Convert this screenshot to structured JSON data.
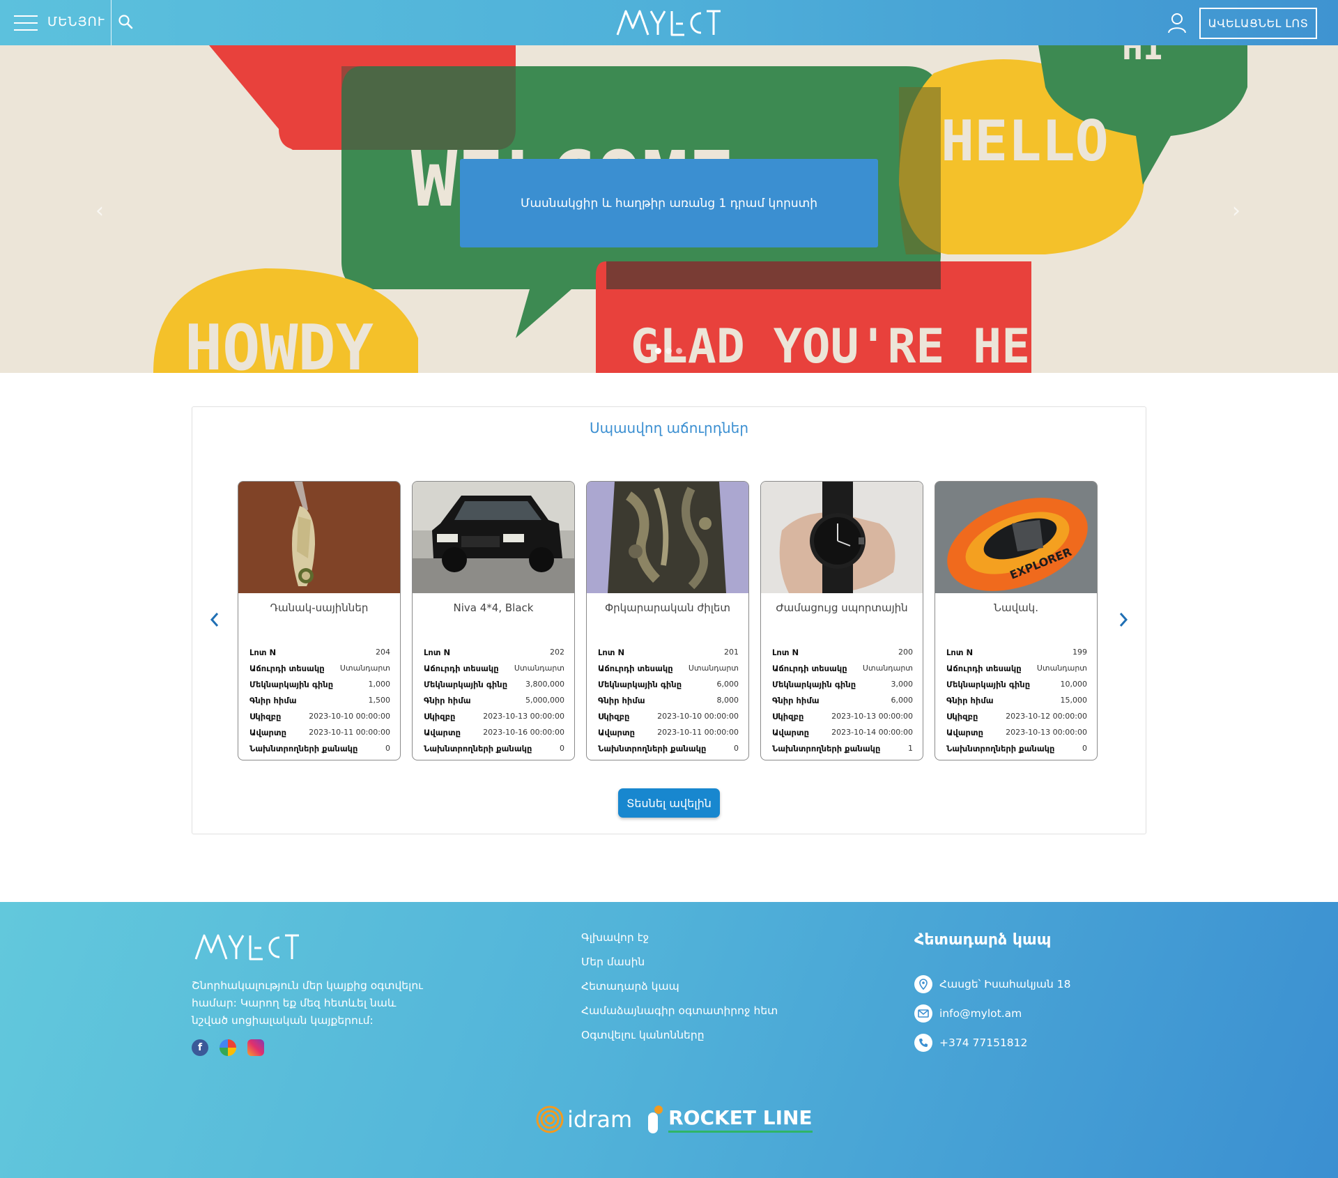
{
  "header": {
    "menu_label": "ՄԵՆՅՈՒ",
    "logo_text": "MYLOT",
    "add_lot_label": "ԱՎԵԼԱՑՆԵԼ ԼՈՏ"
  },
  "hero": {
    "cta_text": "Մասնակցիր և հաղթիր առանց 1 դրամ կորստի",
    "banner_words": [
      "WELCOME",
      "HELLO",
      "HOWDY",
      "GLAD YOU'RE HERE",
      "HI"
    ],
    "slides_count": 3,
    "active_slide": 1
  },
  "auctions": {
    "title": "Սպասվող աճուրդներ",
    "see_more_label": "Տեսնել ավելին",
    "row_labels": [
      "Լոտ N",
      "Աճուրդի տեսակը",
      "Մեկնարկային գինը",
      "Գնիր հիմա",
      "Սկիզբը",
      "Ավարտը",
      "Նախնտրողների քանակը"
    ],
    "cards": [
      {
        "title": "Դանակ-սայիններ",
        "lot": "204",
        "type": "Ստանդարտ",
        "start_price": "1,000",
        "buy_now": "1,500",
        "start": "2023-10-10 00:00:00",
        "end": "2023-10-11 00:00:00",
        "favorites": "0",
        "image": "knife"
      },
      {
        "title": "Niva 4*4, Black",
        "lot": "202",
        "type": "Ստանդարտ",
        "start_price": "3,800,000",
        "buy_now": "5,000,000",
        "start": "2023-10-13 00:00:00",
        "end": "2023-10-16 00:00:00",
        "favorites": "0",
        "image": "car"
      },
      {
        "title": "Փրկարարական ժիլետ",
        "lot": "201",
        "type": "Ստանդարտ",
        "start_price": "6,000",
        "buy_now": "8,000",
        "start": "2023-10-10 00:00:00",
        "end": "2023-10-11 00:00:00",
        "favorites": "0",
        "image": "vest"
      },
      {
        "title": "Ժամացույց սպորտային",
        "lot": "200",
        "type": "Ստանդարտ",
        "start_price": "3,000",
        "buy_now": "6,000",
        "start": "2023-10-13 00:00:00",
        "end": "2023-10-14 00:00:00",
        "favorites": "1",
        "image": "watch"
      },
      {
        "title": "Նավակ.",
        "lot": "199",
        "type": "Ստանդարտ",
        "start_price": "10,000",
        "buy_now": "15,000",
        "start": "2023-10-12 00:00:00",
        "end": "2023-10-13 00:00:00",
        "favorites": "0",
        "image": "boat"
      }
    ]
  },
  "footer": {
    "description": "Շնորհակալություն մեր կայքից օգտվելու համար: Կարող եք մեզ հետևել նաև նշված սոցիալական կայքերում:",
    "links": [
      "Գլխավոր էջ",
      "Մեր մասին",
      "Հետադարձ կապ",
      "Համաձայնագիր օգտատիրոջ հետ",
      "Օգտվելու կանոնները"
    ],
    "contact_title": "Հետադարձ կապ",
    "address": "Հասցե՝ Իսահակյան 18",
    "email": "info@mylot.am",
    "phone": "+374 77151812",
    "partners": {
      "idram": "idram",
      "rocket": "ROCKET LINE"
    }
  },
  "colors": {
    "accent": "#3b8fd1",
    "header_start": "#5cc1dd",
    "header_end": "#3f93d1",
    "button": "#1887cf"
  }
}
